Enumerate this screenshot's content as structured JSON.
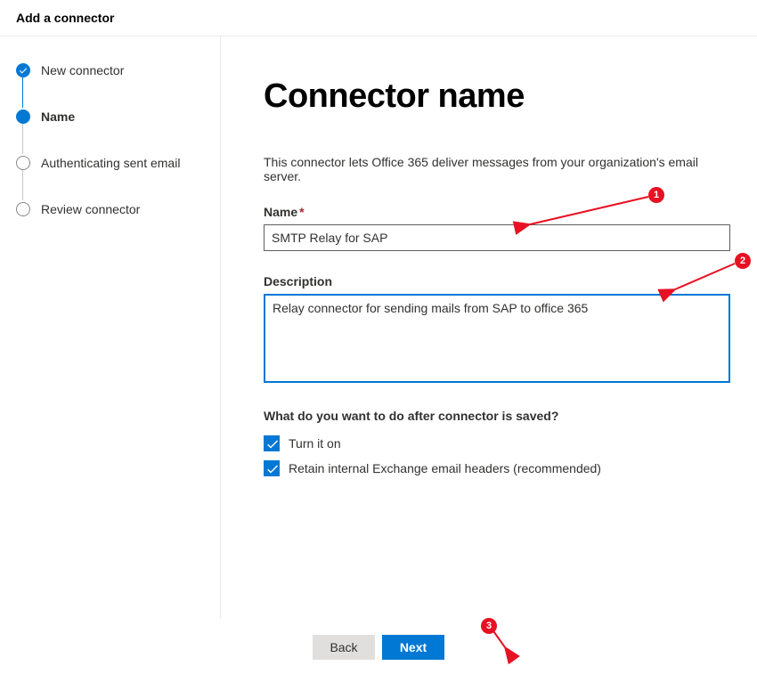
{
  "header": {
    "title": "Add a connector"
  },
  "steps": [
    {
      "label": "New connector",
      "state": "done"
    },
    {
      "label": "Name",
      "state": "current"
    },
    {
      "label": "Authenticating sent email",
      "state": "pending"
    },
    {
      "label": "Review connector",
      "state": "pending"
    }
  ],
  "main": {
    "title": "Connector name",
    "intro": "This connector lets Office 365 deliver messages from your organization's email server.",
    "name_label": "Name",
    "name_value": "SMTP Relay for SAP",
    "desc_label": "Description",
    "desc_value": "Relay connector for sending mails from SAP to office 365",
    "after_save_q": "What do you want to do after connector is saved?",
    "check1_label": "Turn it on",
    "check2_label": "Retain internal Exchange email headers (recommended)"
  },
  "footer": {
    "back_label": "Back",
    "next_label": "Next"
  },
  "annotations": {
    "b1": "1",
    "b2": "2",
    "b3": "3"
  }
}
